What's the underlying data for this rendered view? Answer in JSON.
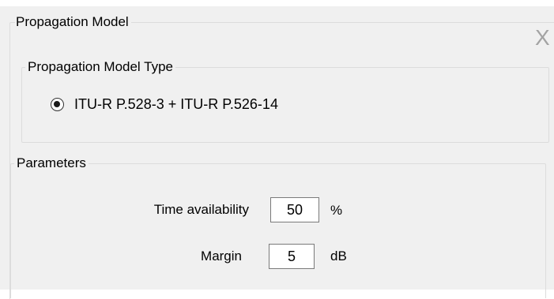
{
  "window": {
    "close_glyph": "X"
  },
  "outer_group": {
    "title": "Propagation Model"
  },
  "type_group": {
    "title": "Propagation Model Type",
    "options": [
      {
        "label": "ITU-R P.528-3 + ITU-R P.526-14",
        "selected": true
      }
    ]
  },
  "parameters": {
    "title": "Parameters",
    "time_availability": {
      "label": "Time availability",
      "value": "50",
      "unit": "%"
    },
    "margin": {
      "label": "Margin",
      "value": "5",
      "unit": "dB"
    }
  },
  "colors": {
    "panel_bg": "#f0f0f0",
    "group_border": "#dcdcdc",
    "input_border": "#7a7a7a",
    "close_icon": "#a3a3a3"
  }
}
